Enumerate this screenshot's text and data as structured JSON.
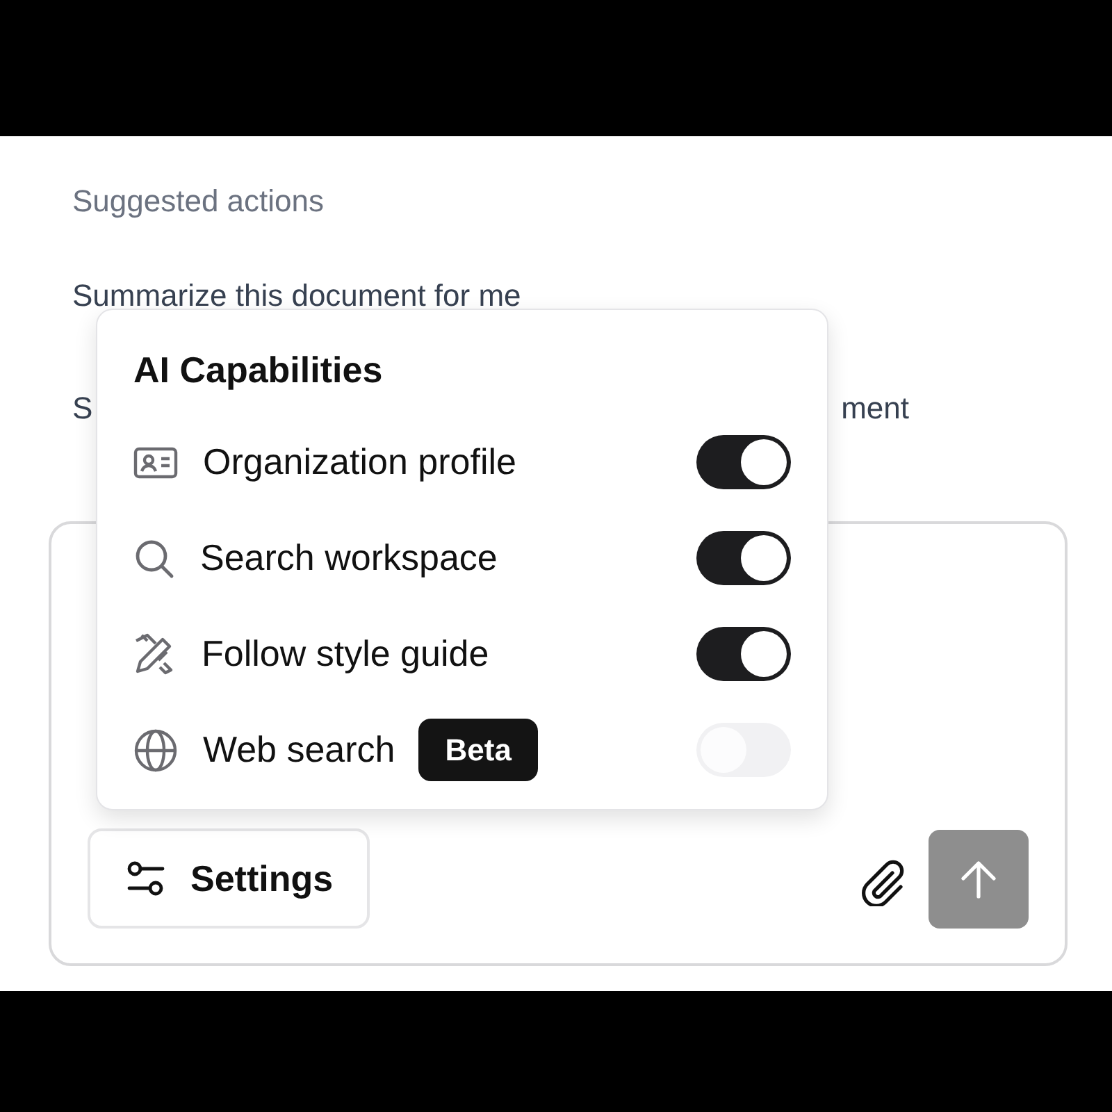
{
  "suggestions": {
    "heading": "Suggested actions",
    "items": [
      {
        "text": "Summarize this document for me"
      },
      {
        "text_start": "S",
        "text_end": "ment"
      }
    ]
  },
  "capabilities": {
    "title": "AI Capabilities",
    "items": [
      {
        "label": "Organization profile",
        "on": true
      },
      {
        "label": "Search workspace",
        "on": true
      },
      {
        "label": "Follow style guide",
        "on": true
      },
      {
        "label": "Web search",
        "badge": "Beta",
        "on": false
      }
    ]
  },
  "composer": {
    "settings_button": "Settings",
    "send_disabled": true
  }
}
